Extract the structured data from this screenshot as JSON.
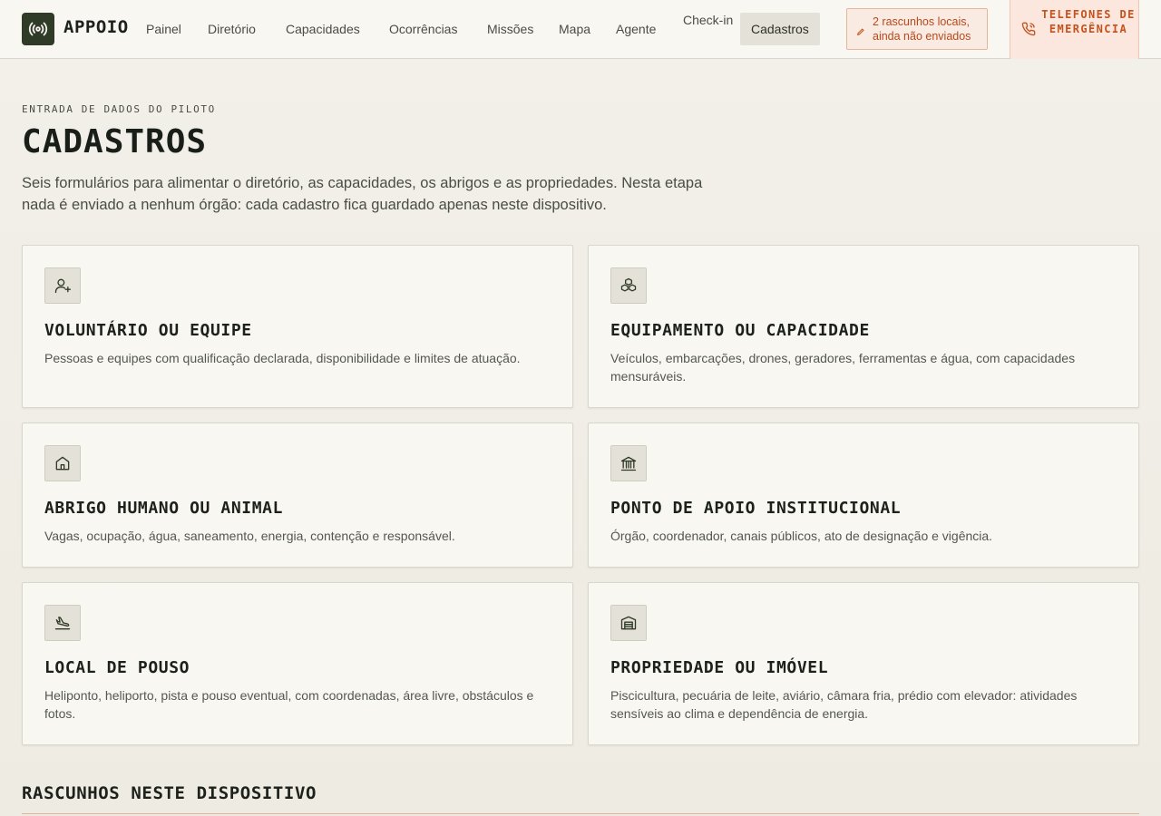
{
  "header": {
    "brand": "APPOIO",
    "nav": [
      {
        "label": "Painel"
      },
      {
        "label": "Diretório"
      },
      {
        "label": "Capacidades"
      },
      {
        "label": "Ocorrências"
      },
      {
        "label": "Missões"
      },
      {
        "label": "Mapa"
      },
      {
        "label": "Agente"
      },
      {
        "label": "Check-in"
      },
      {
        "label": "Cadastros",
        "active": true
      }
    ],
    "drafts_badge": "2 rascunhos locais, ainda não enviados",
    "emergency_button": "TELEFONES DE EMERGÊNCIA"
  },
  "hero": {
    "eyebrow": "ENTRADA DE DADOS DO PILOTO",
    "title": "CADASTROS",
    "lead": "Seis formulários para alimentar o diretório, as capacidades, os abrigos e as propriedades. Nesta etapa nada é enviado a nenhum órgão: cada cadastro fica guardado apenas neste dispositivo."
  },
  "cards": [
    {
      "icon": "user-plus-icon",
      "title": "VOLUNTÁRIO OU EQUIPE",
      "description": "Pessoas e equipes com qualificação declarada, disponibilidade e limites de atuação."
    },
    {
      "icon": "boxes-icon",
      "title": "EQUIPAMENTO OU CAPACIDADE",
      "description": "Veículos, embarcações, drones, geradores, ferramentas e água, com capacidades mensuráveis."
    },
    {
      "icon": "home-icon",
      "title": "ABRIGO HUMANO OU ANIMAL",
      "description": "Vagas, ocupação, água, saneamento, energia, contenção e responsável."
    },
    {
      "icon": "landmark-icon",
      "title": "PONTO DE APOIO INSTITUCIONAL",
      "description": "Órgão, coordenador, canais públicos, ato de designação e vigência."
    },
    {
      "icon": "plane-landing-icon",
      "title": "LOCAL DE POUSO",
      "description": "Heliponto, heliporto, pista e pouso eventual, com coordenadas, área livre, obstáculos e fotos."
    },
    {
      "icon": "warehouse-icon",
      "title": "PROPRIEDADE OU IMÓVEL",
      "description": "Piscicultura, pecuária de leite, aviário, câmara fria, prédio com elevador: atividades sensíveis ao clima e dependência de energia."
    }
  ],
  "drafts_section": {
    "title": "RASCUNHOS NESTE DISPOSITIVO"
  },
  "colors": {
    "brand_dark": "#2f3a27",
    "accent_orange": "#c4521e",
    "background": "#f2f0ea"
  }
}
